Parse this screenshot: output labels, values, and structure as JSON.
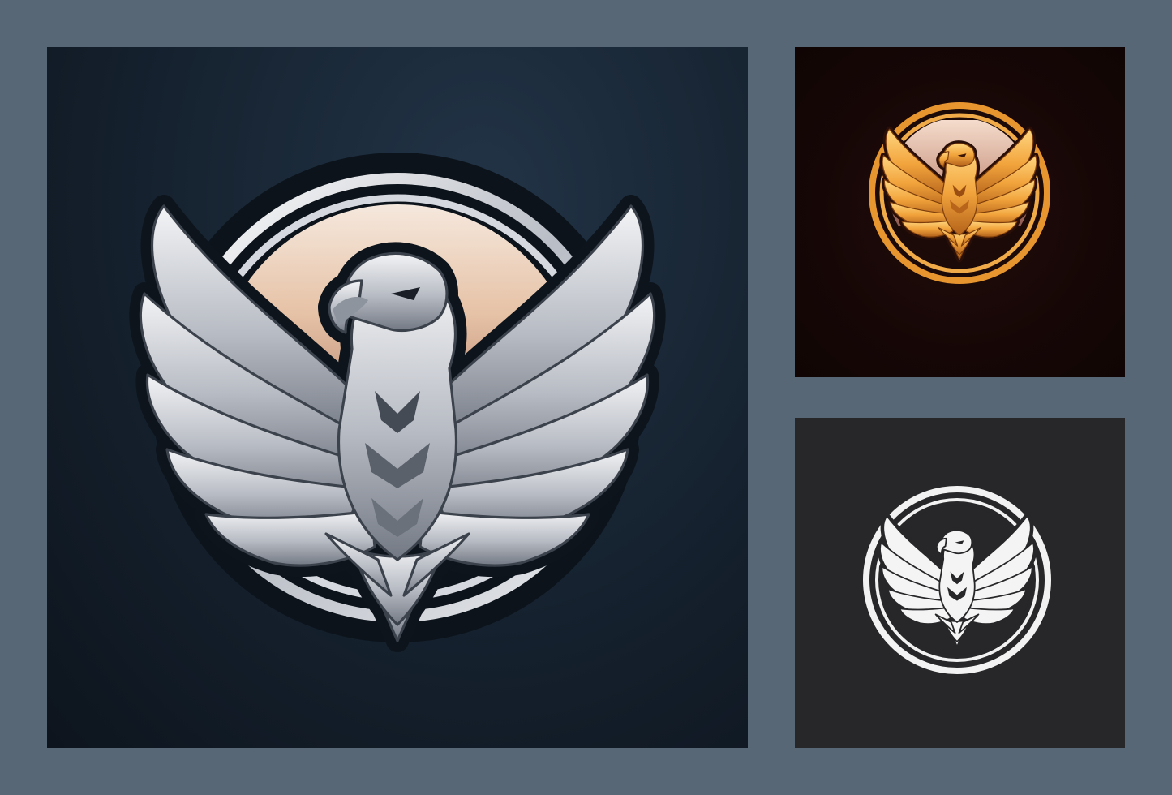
{
  "colors": {
    "page_background": "#586775",
    "main_panel_background": "#15212e",
    "gold_panel_background": "#170706",
    "mono_panel_background": "#272628",
    "silver_light": "#eef0f3",
    "silver_mid": "#a9adb6",
    "silver_dark": "#5b616b",
    "sun_top": "#f6e8dd",
    "sun_bottom": "#b47a62",
    "gold_light": "#ffcf70",
    "gold_mid": "#f0a23a",
    "gold_dark": "#a4530f",
    "mono_white": "#f4f4f4"
  },
  "icons": {
    "main": "silver-eagle-emblem-icon",
    "gold": "gold-eagle-emblem-icon",
    "mono": "white-eagle-emblem-icon"
  }
}
